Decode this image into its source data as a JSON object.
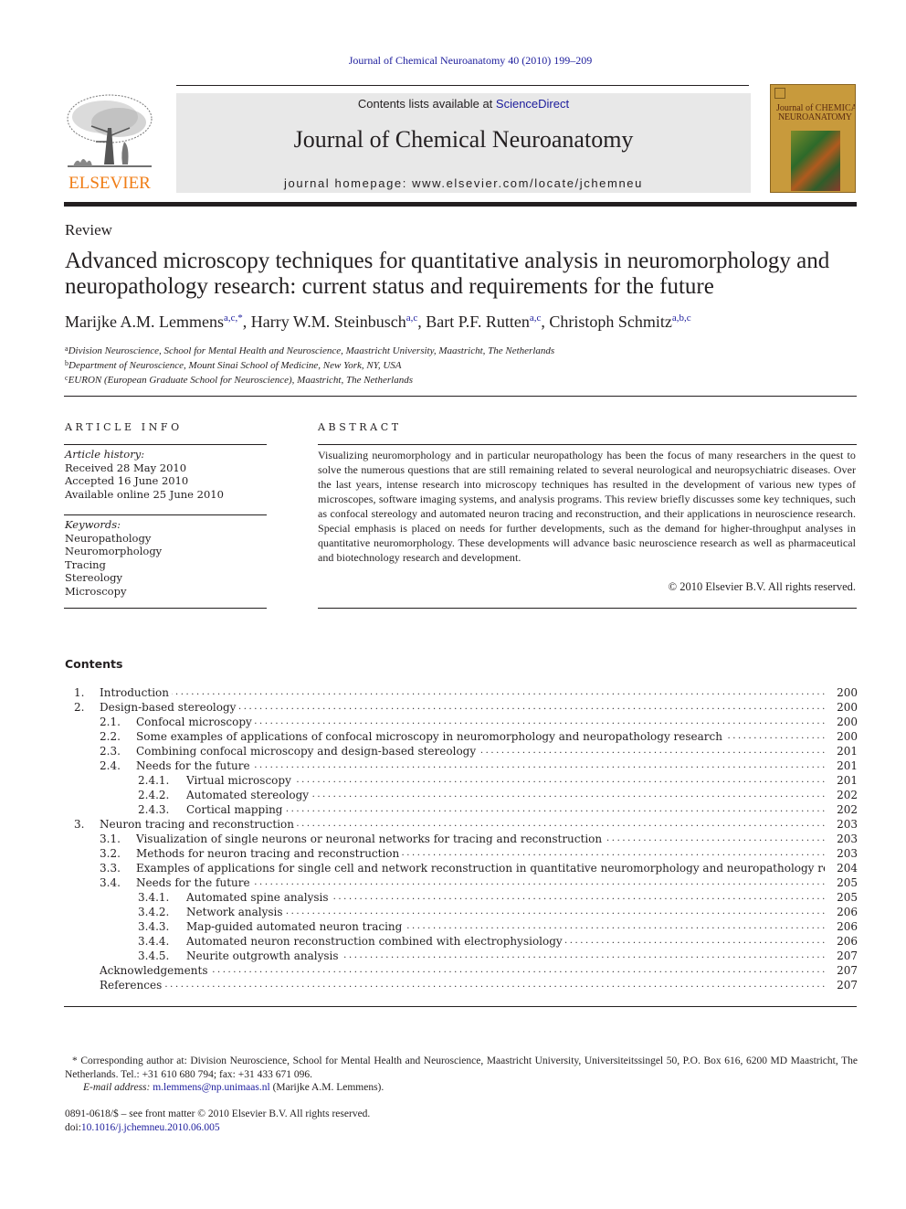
{
  "header": {
    "citation": "Journal of Chemical Neuroanatomy 40 (2010) 199–209",
    "publisher_logo_text": "ELSEVIER",
    "contents_prefix": "Contents lists available at ",
    "contents_link": "ScienceDirect",
    "journal_title": "Journal of Chemical Neuroanatomy",
    "homepage": "journal homepage: www.elsevier.com/locate/jchemneu",
    "cover": {
      "line1": "Journal of CHEMICAL",
      "line2": "NEUROANATOMY"
    },
    "colors": {
      "link": "#1c1c9c",
      "elsevier_orange": "#f07d16",
      "banner_bg": "#e8e8e8"
    }
  },
  "article": {
    "type": "Review",
    "title": "Advanced microscopy techniques for quantitative analysis in neuromorphology and neuropathology research: current status and requirements for the future",
    "authors": [
      {
        "name": "Marijke A.M. Lemmens",
        "sup": "a,c,*",
        "sep": ", "
      },
      {
        "name": "Harry W.M. Steinbusch",
        "sup": "a,c",
        "sep": ", "
      },
      {
        "name": "Bart P.F. Rutten",
        "sup": "a,c",
        "sep": ", "
      },
      {
        "name": "Christoph Schmitz",
        "sup": "a,b,c",
        "sep": ""
      }
    ],
    "affiliations": [
      {
        "mark": "a",
        "text": "Division Neuroscience, School for Mental Health and Neuroscience, Maastricht University, Maastricht, The Netherlands"
      },
      {
        "mark": "b",
        "text": "Department of Neuroscience, Mount Sinai School of Medicine, New York, NY, USA"
      },
      {
        "mark": "c",
        "text": "EURON (European Graduate School for Neuroscience), Maastricht, The Netherlands"
      }
    ]
  },
  "article_info": {
    "heading": "ARTICLE INFO",
    "history_label": "Article history:",
    "history": [
      "Received 28 May 2010",
      "Accepted 16 June 2010",
      "Available online 25 June 2010"
    ],
    "keywords_label": "Keywords:",
    "keywords": [
      "Neuropathology",
      "Neuromorphology",
      "Tracing",
      "Stereology",
      "Microscopy"
    ]
  },
  "abstract": {
    "heading": "ABSTRACT",
    "text": "Visualizing neuromorphology and in particular neuropathology has been the focus of many researchers in the quest to solve the numerous questions that are still remaining related to several neurological and neuropsychiatric diseases. Over the last years, intense research into microscopy techniques has resulted in the development of various new types of microscopes, software imaging systems, and analysis programs. This review briefly discusses some key techniques, such as confocal stereology and automated neuron tracing and reconstruction, and their applications in neuroscience research. Special emphasis is placed on needs for further developments, such as the demand for higher-throughput analyses in quantitative neuromorphology. These developments will advance basic neuroscience research as well as pharmaceutical and biotechnology research and development.",
    "copyright": "© 2010 Elsevier B.V. All rights reserved."
  },
  "contents": {
    "heading": "Contents",
    "items": [
      {
        "level": 1,
        "num": "1.",
        "label": "Introduction",
        "page": "200"
      },
      {
        "level": 1,
        "num": "2.",
        "label": "Design-based stereology",
        "page": "200"
      },
      {
        "level": 2,
        "num": "2.1.",
        "label": "Confocal microscopy",
        "page": "200"
      },
      {
        "level": 2,
        "num": "2.2.",
        "label": "Some examples of applications of confocal microscopy in neuromorphology and neuropathology research",
        "page": "200"
      },
      {
        "level": 2,
        "num": "2.3.",
        "label": "Combining confocal microscopy and design-based stereology",
        "page": "201"
      },
      {
        "level": 2,
        "num": "2.4.",
        "label": "Needs for the future",
        "page": "201"
      },
      {
        "level": 3,
        "num": "2.4.1.",
        "label": "Virtual microscopy",
        "page": "201"
      },
      {
        "level": 3,
        "num": "2.4.2.",
        "label": "Automated stereology",
        "page": "202"
      },
      {
        "level": 3,
        "num": "2.4.3.",
        "label": "Cortical mapping",
        "page": "202"
      },
      {
        "level": 1,
        "num": "3.",
        "label": "Neuron tracing and reconstruction",
        "page": "203"
      },
      {
        "level": 2,
        "num": "3.1.",
        "label": "Visualization of single neurons or neuronal networks for tracing and reconstruction",
        "page": "203"
      },
      {
        "level": 2,
        "num": "3.2.",
        "label": "Methods for neuron tracing and reconstruction",
        "page": "203"
      },
      {
        "level": 2,
        "num": "3.3.",
        "label": "Examples of applications for single cell and network reconstruction in quantitative neuromorphology and neuropathology research.",
        "page": "204"
      },
      {
        "level": 2,
        "num": "3.4.",
        "label": "Needs for the future",
        "page": "205"
      },
      {
        "level": 3,
        "num": "3.4.1.",
        "label": "Automated spine analysis",
        "page": "205"
      },
      {
        "level": 3,
        "num": "3.4.2.",
        "label": "Network analysis",
        "page": "206"
      },
      {
        "level": 3,
        "num": "3.4.3.",
        "label": "Map-guided automated neuron tracing",
        "page": "206"
      },
      {
        "level": 3,
        "num": "3.4.4.",
        "label": "Automated neuron reconstruction combined with electrophysiology",
        "page": "206"
      },
      {
        "level": 3,
        "num": "3.4.5.",
        "label": "Neurite outgrowth analysis",
        "page": "207"
      },
      {
        "level": 0,
        "num": "",
        "label": "Acknowledgements",
        "page": "207"
      },
      {
        "level": 0,
        "num": "",
        "label": "References",
        "page": "207"
      }
    ]
  },
  "footnotes": {
    "corresponding": "* Corresponding author at: Division Neuroscience, School for Mental Health and Neuroscience, Maastricht University, Universiteitssingel 50, P.O. Box 616, 6200 MD Maastricht, The Netherlands. Tel.: +31 610 680 794; fax: +31 433 671 096.",
    "email_label": "E-mail address:",
    "email": "m.lemmens@np.unimaas.nl",
    "email_owner": " (Marijke A.M. Lemmens).",
    "front_matter": "0891-0618/$ – see front matter © 2010 Elsevier B.V. All rights reserved.",
    "doi_prefix": "doi:",
    "doi": "10.1016/j.jchemneu.2010.06.005"
  }
}
